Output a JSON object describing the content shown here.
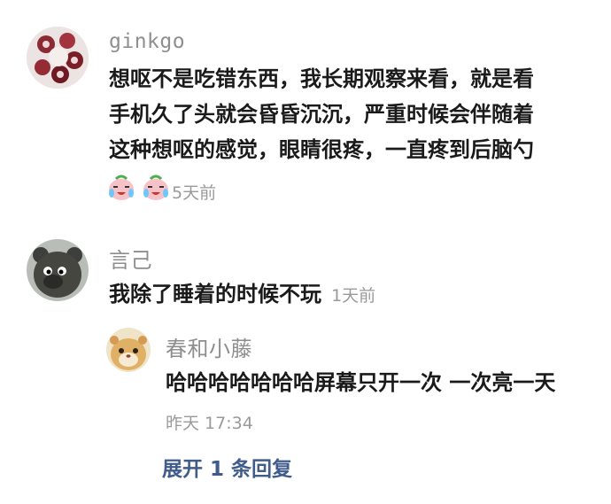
{
  "comments": [
    {
      "username": "ginkgo",
      "lines": [
        "想呕不是吃错东西，我长期观察来看，就是看",
        "手机久了头就会昏昏沉沉，严重时候会伴随着",
        "这种想呕的感觉，眼睛很疼，一直疼到后脑勺"
      ],
      "emojis": [
        "crying-laughing-emoji",
        "crying-laughing-emoji"
      ],
      "time": "5天前",
      "avatar_icon": "flower-cake-avatar-icon"
    },
    {
      "username": "言己",
      "text": "我除了睡着的时候不玩",
      "time": "1天前",
      "avatar_icon": "bear-avatar-icon",
      "reply": {
        "username": "春和小藤",
        "text": "哈哈哈哈哈哈哈屏幕只开一次 一次亮一天",
        "time": "昨天 17:34",
        "avatar_icon": "hamster-avatar-icon"
      },
      "expand_label": "展开 1 条回复"
    }
  ],
  "colors": {
    "username": "#8e8e8e",
    "body": "#1a1a1a",
    "meta": "#9a9a9a",
    "link": "#3f5c8c"
  }
}
